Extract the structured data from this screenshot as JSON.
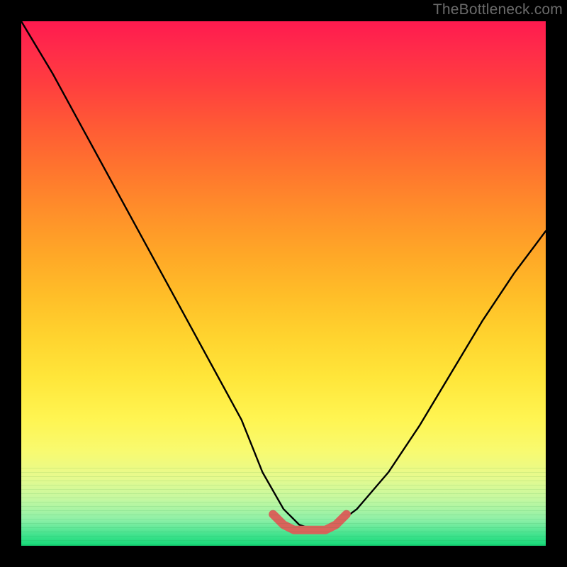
{
  "watermark": "TheBottleneck.com",
  "chart_data": {
    "type": "line",
    "title": "",
    "xlabel": "",
    "ylabel": "",
    "xlim": [
      0,
      100
    ],
    "ylim": [
      0,
      100
    ],
    "grid": false,
    "legend": false,
    "series": [
      {
        "name": "bottleneck-curve",
        "color": "#000000",
        "x": [
          0,
          6,
          12,
          18,
          24,
          30,
          36,
          42,
          46,
          50,
          53,
          56,
          60,
          64,
          70,
          76,
          82,
          88,
          94,
          100
        ],
        "y": [
          100,
          90,
          79,
          68,
          57,
          46,
          35,
          24,
          14,
          7,
          4,
          3,
          4,
          7,
          14,
          23,
          33,
          43,
          52,
          60
        ]
      },
      {
        "name": "optimal-range-marker",
        "color": "#d9635b",
        "x": [
          48,
          50,
          52,
          54,
          56,
          58,
          60,
          62
        ],
        "y": [
          6,
          4,
          3,
          3,
          3,
          3,
          4,
          6
        ]
      }
    ],
    "annotations": []
  }
}
